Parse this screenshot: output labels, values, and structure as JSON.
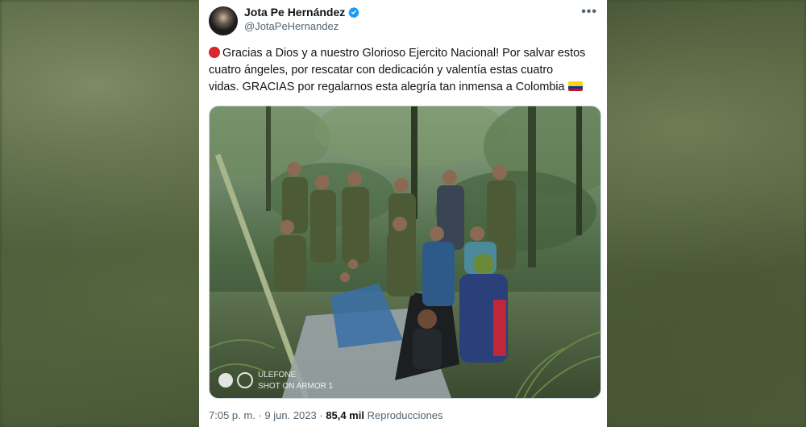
{
  "tweet": {
    "author_name": "Jota Pe Hernández",
    "author_handle": "@JotaPeHernandez",
    "more_icon": "•••",
    "text_line1": "Gracias a Dios y a nuestro Glorioso Ejercito Nacional! Por salvar estos",
    "text_line2": "cuatro ángeles, por rescatar con dedicación y valentía estas cuatro",
    "text_line3": "vidas. GRACIAS por regalarnos esta alegría tan inmensa a Colombia",
    "photo_watermark_line1": "ULEFONE",
    "photo_watermark_line2": "SHOT ON ARMOR 1",
    "time": "7:05 p. m. · 9 jun. 2023 ·",
    "views_count": "85,4 mil",
    "views_label": "Reproducciones"
  },
  "colors": {
    "accent_verified": "#1d9bf0",
    "text_primary": "#0f1419",
    "text_secondary": "#536471",
    "red_circle": "#d7262e"
  },
  "icons": [
    "verified-badge-icon",
    "more-options-icon",
    "red-circle-emoji",
    "colombia-flag-emoji"
  ]
}
